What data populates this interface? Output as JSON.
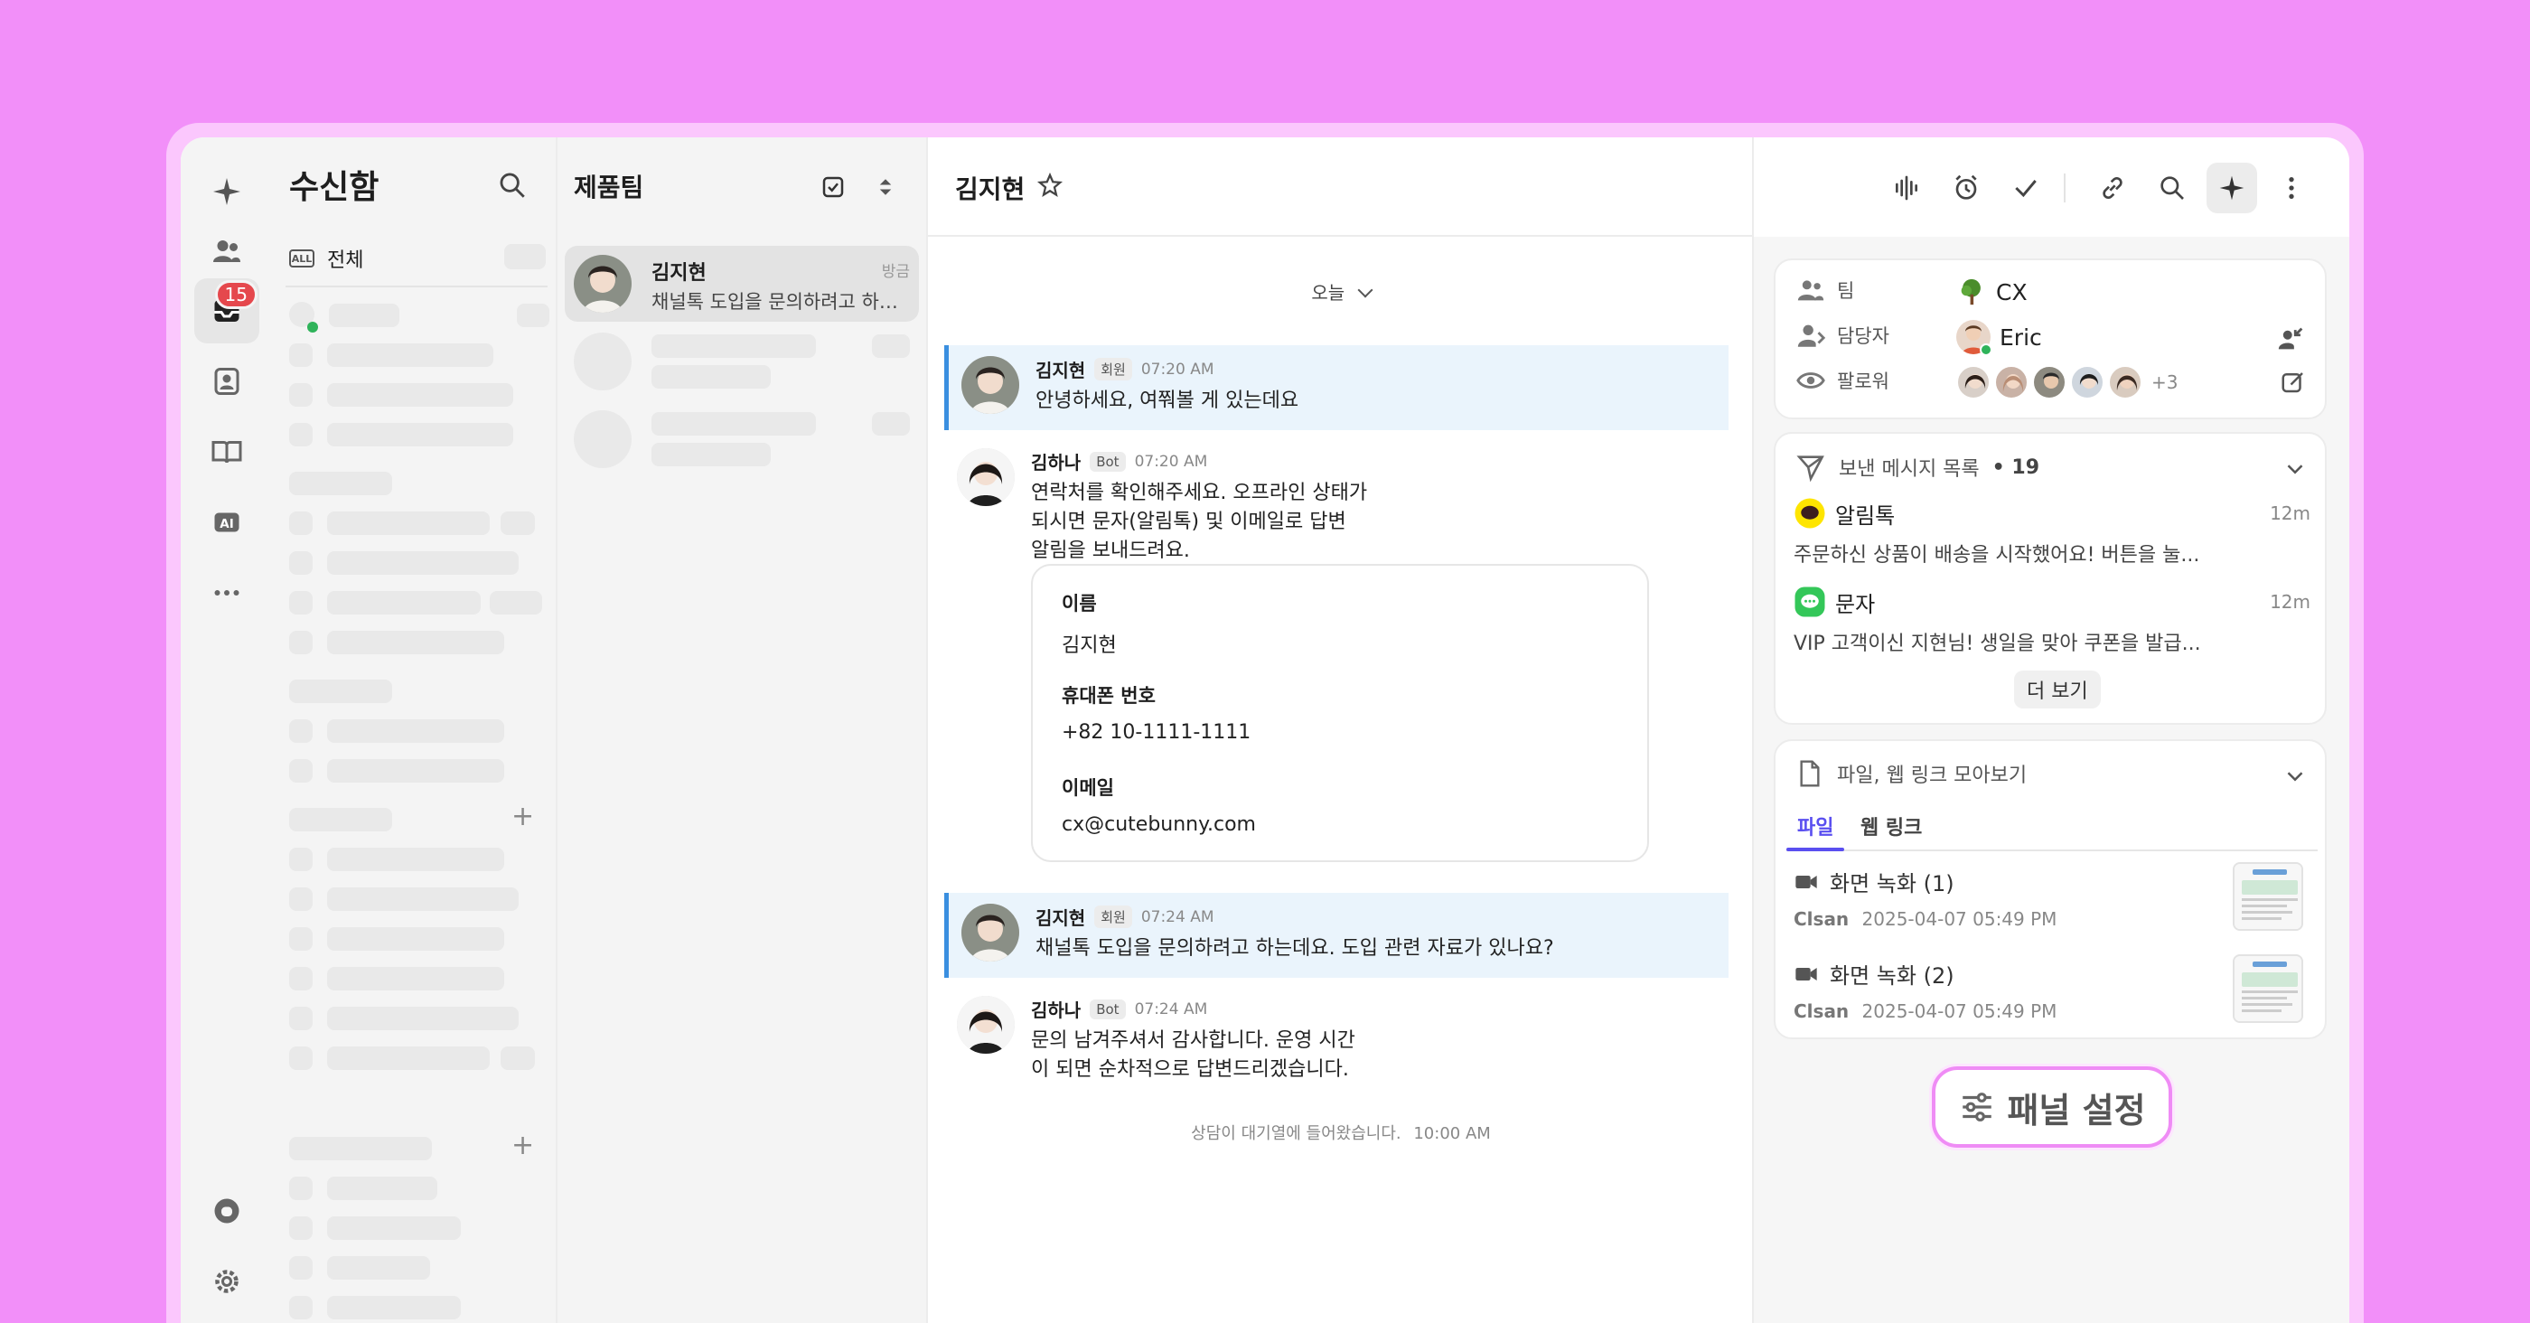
{
  "rail": {
    "badge_count": "15"
  },
  "inbox": {
    "title": "수신함",
    "all_label": "전체",
    "all_icon_text": "ALL"
  },
  "conversations": {
    "team_title": "제품팀",
    "items": [
      {
        "name": "김지현",
        "time": "방금",
        "preview": "채널톡 도입을 문의하려고 하는..."
      }
    ]
  },
  "chat": {
    "title": "김지현",
    "date_separator": "오늘",
    "messages": [
      {
        "name": "김지현",
        "tag": "회원",
        "time": "07:20 AM",
        "text": "안녕하세요, 여쭤볼 게 있는데요"
      },
      {
        "name": "김하나",
        "tag": "Bot",
        "time": "07:20 AM",
        "text": "연락처를 확인해주세요. 오프라인 상태가\n되시면 문자(알림톡) 및 이메일로 답변\n알림을 보내드려요."
      },
      {
        "name": "김지현",
        "tag": "회원",
        "time": "07:24 AM",
        "text": "채널톡 도입을 문의하려고 하는데요. 도입 관련 자료가 있나요?"
      },
      {
        "name": "김하나",
        "tag": "Bot",
        "time": "07:24 AM",
        "text": "문의 남겨주셔서 감사합니다. 운영 시간\n이 되면 순차적으로 답변드리겠습니다."
      }
    ],
    "contact_card": {
      "name_label": "이름",
      "name_value": "김지현",
      "phone_label": "휴대폰 번호",
      "phone_value": "+82 10-1111-1111",
      "email_label": "이메일",
      "email_value": "cx@cutebunny.com"
    },
    "system_message": "상담이 대기열에 들어왔습니다.",
    "system_time": "10:00 AM"
  },
  "panel": {
    "info": {
      "team_label": "팀",
      "team_value": "CX",
      "assignee_label": "담당자",
      "assignee_value": "Eric",
      "followers_label": "팔로워",
      "followers_more": "+3"
    },
    "sent": {
      "title": "보낸 메시지 목록",
      "count": "• 19",
      "items": [
        {
          "channel": "알림톡",
          "time": "12m",
          "body": "주문하신 상품이 배송을 시작했어요! 버튼을 눌..."
        },
        {
          "channel": "문자",
          "time": "12m",
          "body": "VIP 고객이신 지현님! 생일을 맞아 쿠폰을 발급..."
        }
      ],
      "more_label": "더 보기"
    },
    "files": {
      "title": "파일, 웹 링크 모아보기",
      "tabs": [
        "파일",
        "웹 링크"
      ],
      "items": [
        {
          "name": "화면 녹화 (1)",
          "author": "Clsan",
          "date": "2025-04-07 05:49 PM"
        },
        {
          "name": "화면 녹화 (2)",
          "author": "Clsan",
          "date": "2025-04-07 05:49 PM"
        }
      ]
    },
    "settings_label": "패널 설정"
  },
  "colors": {
    "background": "#f28ff9",
    "accent": "#5a4ff0",
    "highlight": "#eaf4fc",
    "badge": "#e5484d"
  },
  "icons": [
    "sparkle-icon",
    "people-icon",
    "inbox-icon",
    "contact-icon",
    "book-icon",
    "ai-icon",
    "more-icon",
    "chat-bubble-icon",
    "gear-icon",
    "search-icon",
    "checkbox-icon",
    "sort-icon",
    "star-icon",
    "waveform-icon",
    "alarm-icon",
    "check-icon",
    "link-icon",
    "kebab-icon",
    "send-icon",
    "file-icon",
    "video-icon",
    "sliders-icon"
  ]
}
